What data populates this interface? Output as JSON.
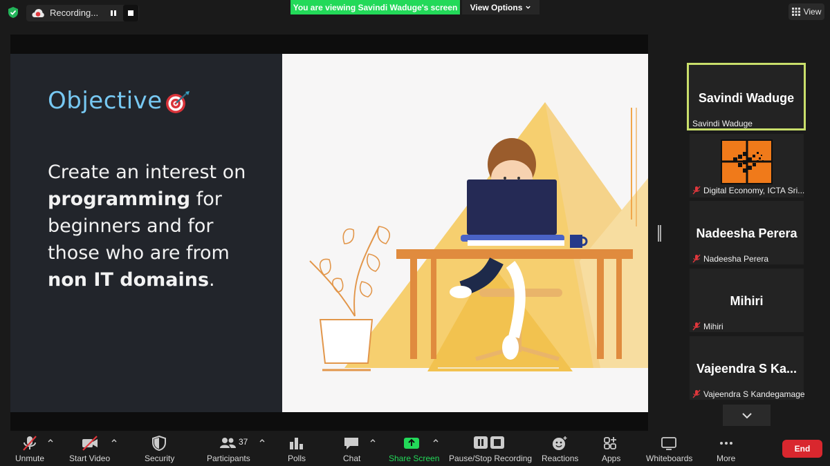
{
  "top": {
    "recording_label": "Recording...",
    "viewing_banner": "You are viewing Savindi Waduge's screen",
    "view_options_label": "View Options",
    "view_label": "View"
  },
  "slide": {
    "title": "Objective",
    "body_parts": [
      "Create an interest on ",
      "programming",
      " for beginners and for those who are from ",
      "non IT domains",
      "."
    ]
  },
  "participants": [
    {
      "big": "Savindi Waduge",
      "small": "Savindi Waduge",
      "muted": false,
      "active": true
    },
    {
      "big": "",
      "small": "Digital Economy, ICTA Sri...",
      "muted": true,
      "active": false
    },
    {
      "big": "Nadeesha Perera",
      "small": "Nadeesha Perera",
      "muted": true,
      "active": false
    },
    {
      "big": "Mihiri",
      "small": "Mihiri",
      "muted": true,
      "active": false
    },
    {
      "big": "Vajeendra  S  Ka...",
      "small": "Vajeendra S Kandegamage",
      "muted": true,
      "active": false
    }
  ],
  "toolbar": {
    "unmute": "Unmute",
    "start_video": "Start Video",
    "security": "Security",
    "participants": "Participants",
    "participant_count": "37",
    "polls": "Polls",
    "chat": "Chat",
    "share_screen": "Share Screen",
    "pause_recording": "Pause/Stop Recording",
    "reactions": "Reactions",
    "apps": "Apps",
    "whiteboards": "Whiteboards",
    "more": "More",
    "end": "End"
  },
  "colors": {
    "banner_green": "#23d959",
    "active_border": "#c9df6b",
    "end_red": "#d9272e",
    "title_blue": "#77c8f2",
    "muted_red": "#e0373c"
  }
}
